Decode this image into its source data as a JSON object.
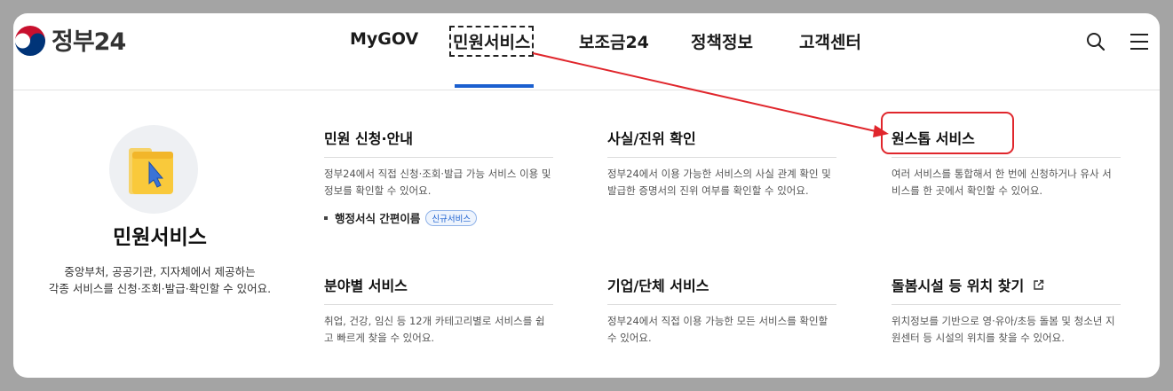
{
  "header": {
    "logo_text": "정부24",
    "nav": [
      {
        "label": "MyGOV"
      },
      {
        "label": "민원서비스"
      },
      {
        "label": "보조금24"
      },
      {
        "label": "정책정보"
      },
      {
        "label": "고객센터"
      }
    ],
    "active_nav": "민원서비스",
    "icons": [
      "search-icon",
      "menu-icon"
    ]
  },
  "intro": {
    "title": "민원서비스",
    "desc_line1": "중앙부처, 공공기관, 지자체에서 제공하는",
    "desc_line2": "각종 서비스를 신청·조회·발급·확인할 수 있어요.",
    "icon": "folder-cursor-icon"
  },
  "services": [
    {
      "title": "민원 신청·안내",
      "desc": "정부24에서 직접 신청·조회·발급 가능 서비스 이용 및 정보를 확인할 수 있어요.",
      "sub_link": "행정서식 간편이름",
      "badge": "신규서비스"
    },
    {
      "title": "사실/진위 확인",
      "desc": "정부24에서 이용 가능한 서비스의 사실 관계 확인 및 발급한 증명서의 진위 여부를 확인할 수 있어요."
    },
    {
      "title": "원스톱 서비스",
      "desc": "여러 서비스를 통합해서 한 번에 신청하거나 유사 서비스를 한 곳에서 확인할 수 있어요."
    },
    {
      "title": "분야별 서비스",
      "desc": "취업, 건강, 임신 등 12개 카테고리별로 서비스를 쉽고 빠르게 찾을 수 있어요."
    },
    {
      "title": "기업/단체 서비스",
      "desc": "정부24에서 직접 이용 가능한 모든 서비스를 확인할 수 있어요."
    },
    {
      "title": "돌봄시설 등 위치 찾기",
      "desc": "위치정보를 기반으로 영·유아/초등 돌봄 및 청소년 지원센터 등 시설의 위치를 찾을 수 있어요.",
      "icon": "external-link-icon"
    }
  ],
  "colors": {
    "accent_blue": "#1a5fcf",
    "annotation_red": "#e0262c",
    "overlay_gray": "#a4a4a4"
  }
}
